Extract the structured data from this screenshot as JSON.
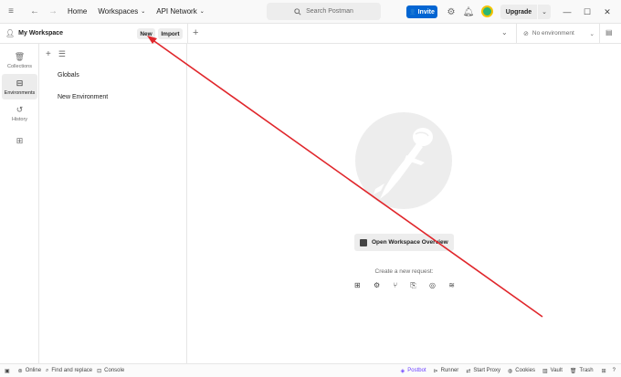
{
  "titlebar": {
    "nav_home": "Home",
    "nav_workspaces": "Workspaces",
    "nav_api_network": "API Network",
    "search_placeholder": "Search Postman",
    "invite_label": "Invite",
    "upgrade_label": "Upgrade"
  },
  "workspace": {
    "title": "My Workspace",
    "new_label": "New",
    "import_label": "Import"
  },
  "environment_selector": {
    "selected": "No environment"
  },
  "sidebar": {
    "items": [
      {
        "label": "Collections",
        "icon": "collections-icon",
        "active": false
      },
      {
        "label": "Environments",
        "icon": "environments-icon",
        "active": true
      },
      {
        "label": "History",
        "icon": "history-icon",
        "active": false
      },
      {
        "label": "",
        "icon": "configure-sidebar-icon",
        "active": false
      }
    ]
  },
  "environments": {
    "list": [
      "Globals",
      "New Environment"
    ]
  },
  "main": {
    "open_overview_label": "Open Workspace Overview",
    "create_request_label": "Create a new request:",
    "request_types": [
      "http-icon",
      "graphql-icon",
      "grpc-icon",
      "websocket-icon",
      "socketio-icon",
      "mqtt-icon"
    ]
  },
  "statusbar": {
    "online": "Online",
    "find_replace": "Find and replace",
    "console": "Console",
    "postbot": "Postbot",
    "runner": "Runner",
    "start_proxy": "Start Proxy",
    "cookies": "Cookies",
    "vault": "Vault",
    "trash": "Trash"
  },
  "colors": {
    "accent_blue": "#0265d2",
    "postbot_purple": "#6e44ff",
    "annotation_red": "#e0262b"
  }
}
